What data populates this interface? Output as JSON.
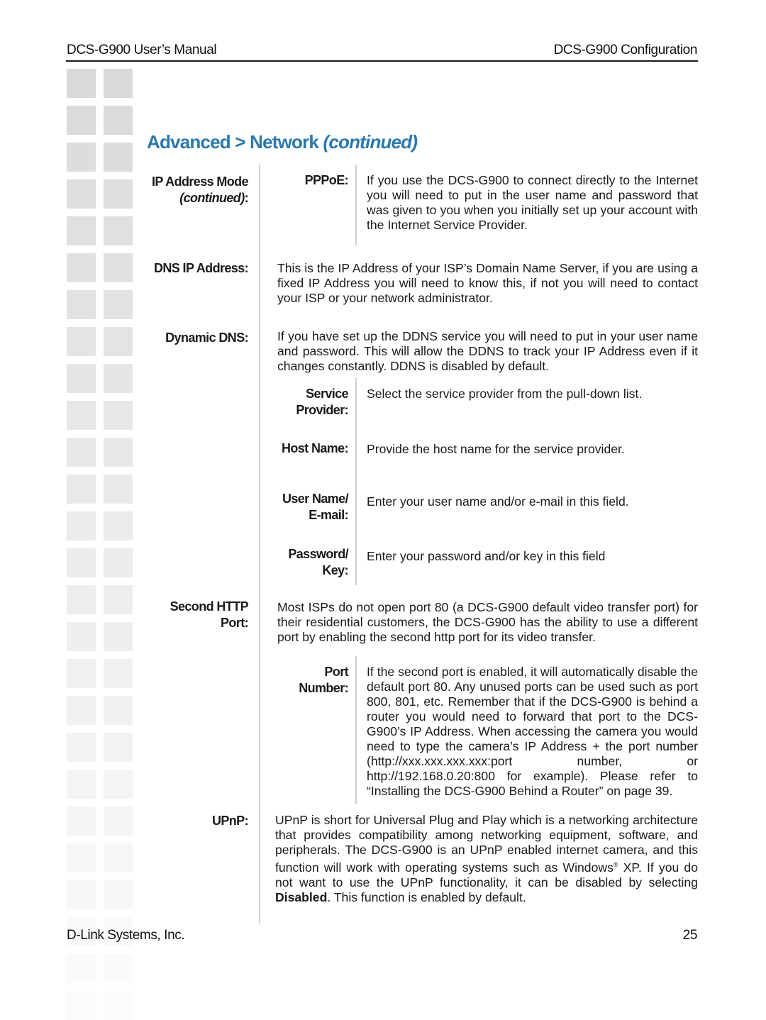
{
  "header": {
    "left": "DCS-G900 User’s Manual",
    "right": "DCS-G900 Configuration"
  },
  "title": {
    "main": "Advanced > Network ",
    "suffix": "(continued)"
  },
  "sections": {
    "ip_mode": {
      "label": "IP Address Mode",
      "label_suffix": "(continued)",
      "label_colon": ":",
      "pppoe": {
        "label": "PPPoE:",
        "text": "If you use the DCS-G900 to connect directly to the Internet you will need to put in the user name and password that was given to you when you initially set up your account with the Internet Service Provider."
      }
    },
    "dns_ip": {
      "label": "DNS IP Address:",
      "text": "This is the IP Address of your ISP’s Domain Name Server, if you are using a fixed IP Address you will need to know this, if not you will need to contact your ISP or your network administrator."
    },
    "dynamic_dns": {
      "label": "Dynamic DNS:",
      "text": "If you have set up the DDNS service you will need to put in your user name and password. This will allow the DDNS to track your IP Address even if it changes constantly. DDNS is disabled by default.",
      "items": [
        {
          "label_l1": "Service",
          "label_l2": "Provider:",
          "text": "Select the service provider from the pull-down list."
        },
        {
          "label_l1": "Host Name:",
          "label_l2": "",
          "text": "Provide the host name for the service provider."
        },
        {
          "label_l1": "User Name/",
          "label_l2": "E-mail:",
          "text": "Enter your user name and/or e-mail in this field."
        },
        {
          "label_l1": "Password/",
          "label_l2": "Key:",
          "text": "Enter your password and/or key in this field"
        }
      ]
    },
    "second_http": {
      "label_l1": "Second HTTP",
      "label_l2": "Port:",
      "text": "Most ISPs do not open port 80 (a DCS-G900 default video transfer port) for their residential customers, the DCS-G900 has the ability to use a different port by enabling the second http port for its video transfer.",
      "port_number": {
        "label_l1": "Port",
        "label_l2": "Number:",
        "text": "If the second port is enabled, it will automatically disable the default port 80. Any unused ports can be used such as port 800, 801, etc. Remember that if the DCS-G900 is behind a router you would need to forward that port to the DCS-G900’s IP Address. When accessing the camera you would need to type the camera’s IP Address + the port number (http://xxx.xxx.xxx.xxx:port number, or http://192.168.0.20:800 for example). Please refer to “Installing the DCS-G900 Behind a Router” on page 39."
      }
    },
    "upnp": {
      "label": "UPnP:",
      "text_a": "UPnP is short for Universal Plug and Play which is a networking architecture that provides compatibility among networking equipment, software, and peripherals. The DCS-G900 is an UPnP enabled internet camera, and this function will work with operating systems such as Windows",
      "reg": "®",
      "text_b": " XP. If you do not want to use the UPnP functionality, it can be disabled by selecting ",
      "bold": "Disabled",
      "text_c": ". This function is enabled by default."
    }
  },
  "footer": {
    "left": "D-Link Systems, Inc.",
    "page": "25"
  },
  "colors": {
    "title": "#2b78ab",
    "rule": "#1a1a1a",
    "divider": "#cfcfcf"
  }
}
